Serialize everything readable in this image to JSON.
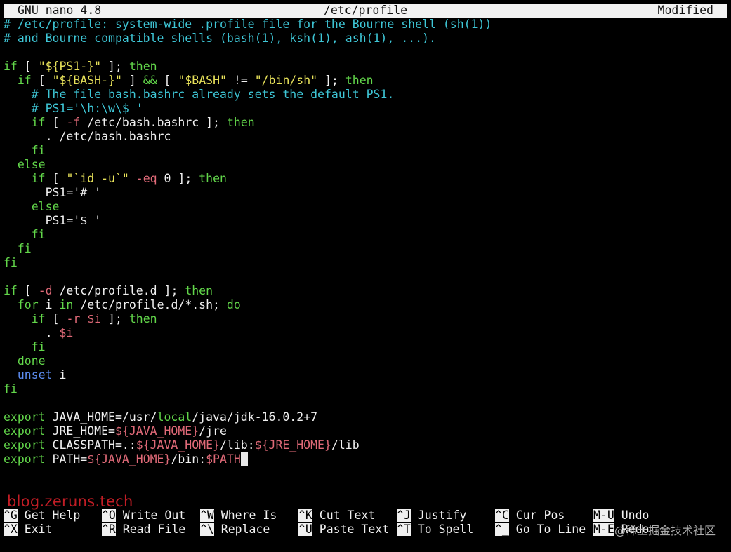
{
  "title_bar": {
    "app": "GNU nano 4.8",
    "file": "/etc/profile",
    "status": "Modified"
  },
  "lines": [
    {
      "p": [
        {
          "t": "# /etc/profile: system-wide .profile file for the Bourne shell (sh(1))",
          "c": "c"
        }
      ]
    },
    {
      "p": [
        {
          "t": "# and Bourne compatible shells (bash(1), ksh(1), ash(1), ...).",
          "c": "c"
        }
      ]
    },
    {
      "p": []
    },
    {
      "p": [
        {
          "t": "if",
          "c": "k"
        },
        {
          "t": " [ "
        },
        {
          "t": "\"${PS1-}\"",
          "c": "s"
        },
        {
          "t": " ]; "
        },
        {
          "t": "then",
          "c": "k"
        }
      ]
    },
    {
      "p": [
        {
          "t": "  "
        },
        {
          "t": "if",
          "c": "k"
        },
        {
          "t": " [ "
        },
        {
          "t": "\"${BASH-}\"",
          "c": "s"
        },
        {
          "t": " ] "
        },
        {
          "t": "&&",
          "c": "k"
        },
        {
          "t": " [ "
        },
        {
          "t": "\"$BASH\"",
          "c": "s"
        },
        {
          "t": " != "
        },
        {
          "t": "\"/bin/sh\"",
          "c": "s"
        },
        {
          "t": " ]; "
        },
        {
          "t": "then",
          "c": "k"
        }
      ]
    },
    {
      "p": [
        {
          "t": "    "
        },
        {
          "t": "# The file bash.bashrc already sets the default PS1.",
          "c": "c"
        }
      ]
    },
    {
      "p": [
        {
          "t": "    "
        },
        {
          "t": "# PS1='\\h:\\w\\$ '",
          "c": "c"
        }
      ]
    },
    {
      "p": [
        {
          "t": "    "
        },
        {
          "t": "if",
          "c": "k"
        },
        {
          "t": " [ "
        },
        {
          "t": "-f",
          "c": "v"
        },
        {
          "t": " /etc/bash.bashrc ]; "
        },
        {
          "t": "then",
          "c": "k"
        }
      ]
    },
    {
      "p": [
        {
          "t": "      . /etc/bash.bashrc"
        }
      ]
    },
    {
      "p": [
        {
          "t": "    "
        },
        {
          "t": "fi",
          "c": "k"
        }
      ]
    },
    {
      "p": [
        {
          "t": "  "
        },
        {
          "t": "else",
          "c": "k"
        }
      ]
    },
    {
      "p": [
        {
          "t": "    "
        },
        {
          "t": "if",
          "c": "k"
        },
        {
          "t": " [ "
        },
        {
          "t": "\"`id -u`\"",
          "c": "s"
        },
        {
          "t": " "
        },
        {
          "t": "-eq",
          "c": "v"
        },
        {
          "t": " 0 ]; "
        },
        {
          "t": "then",
          "c": "k"
        }
      ]
    },
    {
      "p": [
        {
          "t": "      PS1='# '"
        }
      ]
    },
    {
      "p": [
        {
          "t": "    "
        },
        {
          "t": "else",
          "c": "k"
        }
      ]
    },
    {
      "p": [
        {
          "t": "      PS1='$ '"
        }
      ]
    },
    {
      "p": [
        {
          "t": "    "
        },
        {
          "t": "fi",
          "c": "k"
        }
      ]
    },
    {
      "p": [
        {
          "t": "  "
        },
        {
          "t": "fi",
          "c": "k"
        }
      ]
    },
    {
      "p": [
        {
          "t": "fi",
          "c": "k"
        }
      ]
    },
    {
      "p": []
    },
    {
      "p": [
        {
          "t": "if",
          "c": "k"
        },
        {
          "t": " [ "
        },
        {
          "t": "-d",
          "c": "v"
        },
        {
          "t": " /etc/profile.d ]; "
        },
        {
          "t": "then",
          "c": "k"
        }
      ]
    },
    {
      "p": [
        {
          "t": "  "
        },
        {
          "t": "for",
          "c": "k"
        },
        {
          "t": " i "
        },
        {
          "t": "in",
          "c": "k"
        },
        {
          "t": " /etc/profile.d/*.sh; "
        },
        {
          "t": "do",
          "c": "k"
        }
      ]
    },
    {
      "p": [
        {
          "t": "    "
        },
        {
          "t": "if",
          "c": "k"
        },
        {
          "t": " [ "
        },
        {
          "t": "-r",
          "c": "v"
        },
        {
          "t": " "
        },
        {
          "t": "$i",
          "c": "v"
        },
        {
          "t": " ]; "
        },
        {
          "t": "then",
          "c": "k"
        }
      ]
    },
    {
      "p": [
        {
          "t": "      . "
        },
        {
          "t": "$i",
          "c": "v"
        }
      ]
    },
    {
      "p": [
        {
          "t": "    "
        },
        {
          "t": "fi",
          "c": "k"
        }
      ]
    },
    {
      "p": [
        {
          "t": "  "
        },
        {
          "t": "done",
          "c": "k"
        }
      ]
    },
    {
      "p": [
        {
          "t": "  "
        },
        {
          "t": "unset",
          "c": "u"
        },
        {
          "t": " i"
        }
      ]
    },
    {
      "p": [
        {
          "t": "fi",
          "c": "k"
        }
      ]
    },
    {
      "p": []
    },
    {
      "p": [
        {
          "t": "export",
          "c": "k"
        },
        {
          "t": " JAVA_HOME=/usr/"
        },
        {
          "t": "local",
          "c": "k"
        },
        {
          "t": "/java/jdk-16.0.2+7"
        }
      ]
    },
    {
      "p": [
        {
          "t": "export",
          "c": "k"
        },
        {
          "t": " JRE_HOME="
        },
        {
          "t": "${JAVA_HOME}",
          "c": "v"
        },
        {
          "t": "/jre"
        }
      ]
    },
    {
      "p": [
        {
          "t": "export",
          "c": "k"
        },
        {
          "t": " CLASSPATH=.:"
        },
        {
          "t": "${JAVA_HOME}",
          "c": "v"
        },
        {
          "t": "/lib:"
        },
        {
          "t": "${JRE_HOME}",
          "c": "v"
        },
        {
          "t": "/lib"
        }
      ]
    },
    {
      "p": [
        {
          "t": "export",
          "c": "k"
        },
        {
          "t": " PATH="
        },
        {
          "t": "${JAVA_HOME}",
          "c": "v"
        },
        {
          "t": "/bin:"
        },
        {
          "t": "$PATH",
          "c": "v"
        }
      ],
      "cursor": true
    }
  ],
  "watermark": "blog.zeruns.tech",
  "watermark2": "@稀土掘金技术社区",
  "shortcuts": [
    {
      "key": "^G",
      "label": "Get Help"
    },
    {
      "key": "^O",
      "label": "Write Out"
    },
    {
      "key": "^W",
      "label": "Where Is"
    },
    {
      "key": "^K",
      "label": "Cut Text"
    },
    {
      "key": "^J",
      "label": "Justify"
    },
    {
      "key": "^C",
      "label": "Cur Pos"
    },
    {
      "key": "M-U",
      "label": "Undo"
    },
    {
      "key": "^X",
      "label": "Exit"
    },
    {
      "key": "^R",
      "label": "Read File"
    },
    {
      "key": "^\\",
      "label": "Replace"
    },
    {
      "key": "^U",
      "label": "Paste Text"
    },
    {
      "key": "^T",
      "label": "To Spell"
    },
    {
      "key": "^_",
      "label": "Go To Line"
    },
    {
      "key": "M-E",
      "label": "Redo"
    }
  ]
}
